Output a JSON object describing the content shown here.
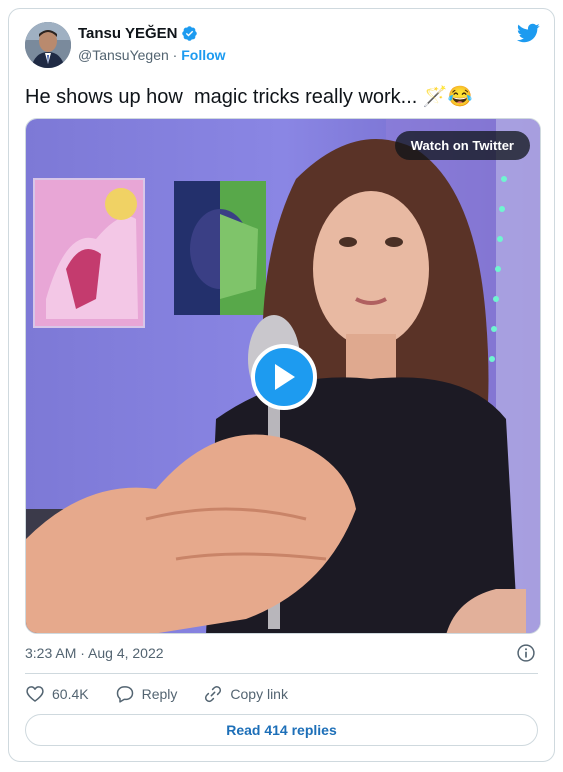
{
  "author": {
    "name": "Tansu YEĞEN",
    "handle": "@TansuYegen",
    "separator": "·",
    "follow_label": "Follow"
  },
  "tweet": {
    "text": "He shows up how  magic tricks really work... 🪄😂"
  },
  "media": {
    "watch_label": "Watch on Twitter"
  },
  "timestamp": "3:23 AM · Aug 4, 2022",
  "actions": {
    "likes": "60.4K",
    "reply_label": "Reply",
    "copy_label": "Copy link"
  },
  "read_replies_label": "Read 414 replies",
  "colors": {
    "accent": "#1d9bf0",
    "text": "#0f1419",
    "muted": "#536471",
    "border": "#cfd9de"
  },
  "icons": [
    "twitter-bird-icon",
    "verified-badge-icon",
    "play-icon",
    "info-icon",
    "heart-icon",
    "reply-icon",
    "link-icon"
  ]
}
